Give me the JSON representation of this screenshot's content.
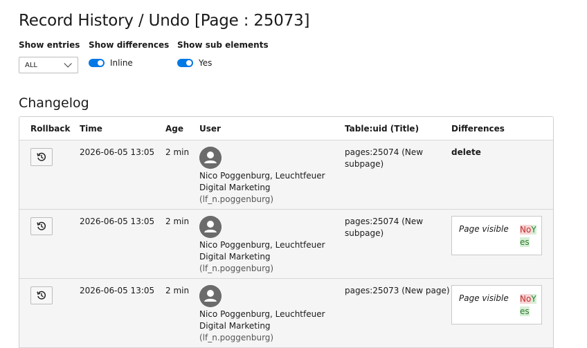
{
  "page_title": "Record History / Undo [Page : 25073]",
  "controls": {
    "show_entries_label": "Show entries",
    "show_entries_value": "ALL",
    "show_differences_label": "Show differences",
    "show_differences_value": "Inline",
    "show_sub_elements_label": "Show sub elements",
    "show_sub_elements_value": "Yes"
  },
  "changelog": {
    "title": "Changelog",
    "columns": [
      "Rollback",
      "Time",
      "Age",
      "User",
      "Table:uid (Title)",
      "Differences"
    ],
    "rows": [
      {
        "time": "2026-06-05 13:05",
        "age": "2 min",
        "user_name": "Nico Poggenburg, Leuchtfeuer Digital Marketing",
        "user_login": "(lf_n.poggenburg)",
        "table_uid": "pages:25074 (New subpage)",
        "diff_action": "delete"
      },
      {
        "time": "2026-06-05 13:05",
        "age": "2 min",
        "user_name": "Nico Poggenburg, Leuchtfeuer Digital Marketing",
        "user_login": "(lf_n.poggenburg)",
        "table_uid": "pages:25074 (New subpage)",
        "diff_field": "Page visible",
        "diff_removed": "No",
        "diff_added": "Yes"
      },
      {
        "time": "2026-06-05 13:05",
        "age": "2 min",
        "user_name": "Nico Poggenburg, Leuchtfeuer Digital Marketing",
        "user_login": "(lf_n.poggenburg)",
        "table_uid": "pages:25073 (New page)",
        "diff_field": "Page visible",
        "diff_removed": "No",
        "diff_added": "Yes"
      }
    ]
  },
  "icons": {
    "rollback": "history-icon",
    "chevron": "chevron-down-icon",
    "avatar": "user-avatar-icon"
  },
  "colors": {
    "toggle_on": "#0078e6",
    "diff_removed_bg": "#f6d5d5",
    "diff_removed_text": "#c03030",
    "diff_added_bg": "#d6efd6",
    "diff_added_text": "#2f7a2f",
    "row_bg": "#f5f5f5"
  }
}
